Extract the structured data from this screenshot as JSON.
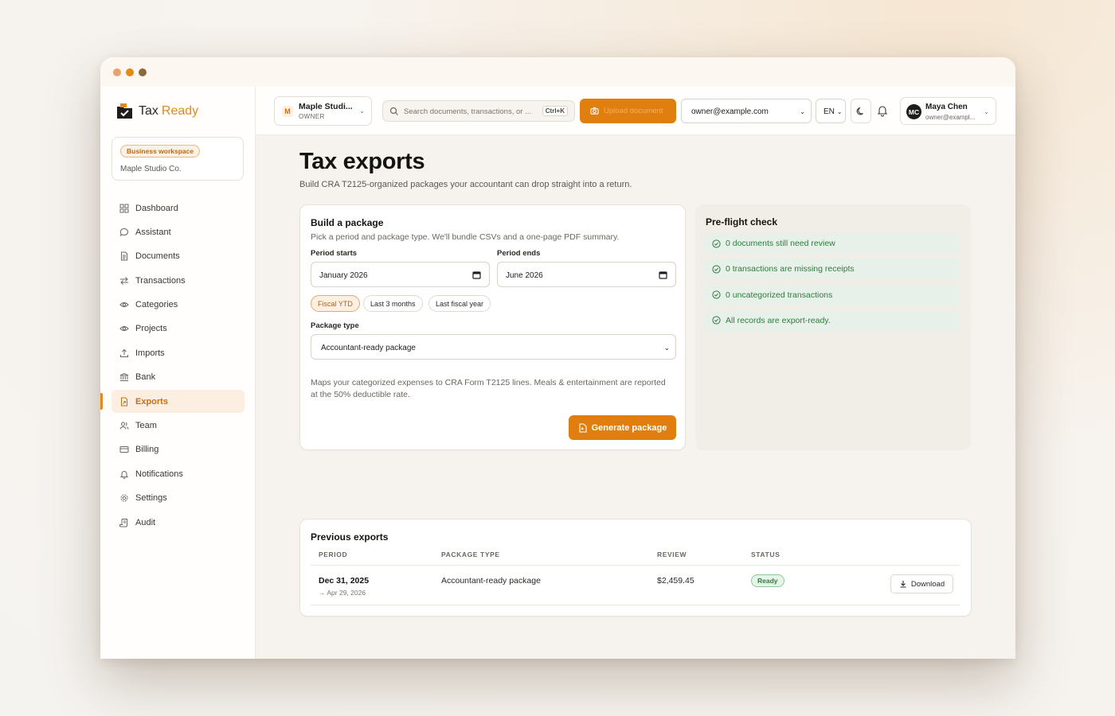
{
  "brand": {
    "tax": "Tax",
    "ready": "Ready"
  },
  "workspace": {
    "badge": "Business workspace",
    "name": "Maple Studio Co."
  },
  "sidebar": {
    "items": [
      {
        "label": "Dashboard",
        "icon": "grid-icon"
      },
      {
        "label": "Assistant",
        "icon": "chat-bubble-icon"
      },
      {
        "label": "Documents",
        "icon": "document-icon"
      },
      {
        "label": "Transactions",
        "icon": "swap-arrows-icon"
      },
      {
        "label": "Categories",
        "icon": "eye-icon"
      },
      {
        "label": "Projects",
        "icon": "eye-icon"
      },
      {
        "label": "Imports",
        "icon": "upload-icon"
      },
      {
        "label": "Bank",
        "icon": "bank-icon"
      },
      {
        "label": "Exports",
        "icon": "file-export-icon",
        "active": true
      },
      {
        "label": "Team",
        "icon": "users-icon"
      },
      {
        "label": "Billing",
        "icon": "card-icon"
      },
      {
        "label": "Notifications",
        "icon": "bell-icon"
      },
      {
        "label": "Settings",
        "icon": "gear-icon"
      },
      {
        "label": "Audit",
        "icon": "scroll-icon"
      }
    ]
  },
  "topbar": {
    "org_initial": "M",
    "org_name": "Maple Studi...",
    "org_role": "OWNER",
    "search_placeholder": "Search documents, transactions, or ...",
    "search_shortcut": "Ctrl+K",
    "upload_label": "Upload document",
    "email": "owner@example.com",
    "lang": "EN",
    "user_initials": "MC",
    "user_name": "Maya Chen",
    "user_email": "owner@exampl..."
  },
  "page": {
    "title": "Tax exports",
    "subtitle": "Build CRA T2125-organized packages your accountant can drop straight into a return."
  },
  "build": {
    "title": "Build a package",
    "subtitle": "Pick a period and package type. We'll bundle CSVs and a one-page PDF summary.",
    "period_starts_label": "Period starts",
    "period_starts_value": "January  2026",
    "period_ends_label": "Period ends",
    "period_ends_value": "June  2026",
    "chips": [
      "Fiscal YTD",
      "Last 3 months",
      "Last fiscal year"
    ],
    "package_type_label": "Package type",
    "package_type_value": "Accountant-ready package",
    "description": "Maps your categorized expenses to CRA Form T2125 lines. Meals & entertainment are reported at the 50% deductible rate.",
    "generate_label": "Generate package"
  },
  "preflight": {
    "title": "Pre-flight check",
    "items": [
      "0 documents still need review",
      "0 transactions are missing receipts",
      "0 uncategorized transactions",
      "All records are export-ready."
    ]
  },
  "previous": {
    "title": "Previous exports",
    "headers": [
      "PERIOD",
      "PACKAGE TYPE",
      "REVIEW",
      "STATUS"
    ],
    "rows": [
      {
        "period": "Dec 31, 2025",
        "period_sub": "→ Apr 29, 2026",
        "package_type": "Accountant-ready package",
        "review": "$2,459.45",
        "status": "Ready",
        "action": "Download"
      }
    ]
  },
  "colors": {
    "accent": "#e07e0f",
    "success": "#2f7b3e"
  }
}
